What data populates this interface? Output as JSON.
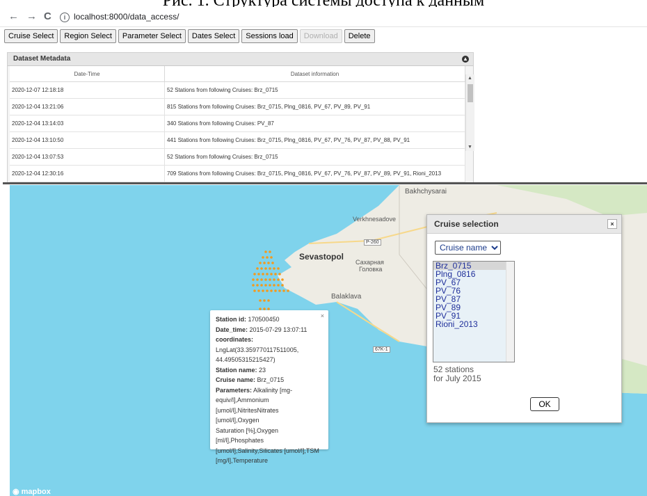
{
  "caption": "Рис. 1. Структура системы доступа к данным",
  "browser": {
    "back_icon": "←",
    "forward_icon": "→",
    "reload_icon": "C",
    "url": "localhost:8000/data_access/"
  },
  "toolbar": {
    "buttons": [
      "Cruise Select",
      "Region Select",
      "Parameter Select",
      "Dates Select",
      "Sessions load",
      "Download",
      "Delete"
    ]
  },
  "metadata": {
    "title": "Dataset Metadata",
    "columns": [
      "Date-Time",
      "Dataset information"
    ],
    "rows": [
      [
        "2020-12-07 12:18:18",
        "52 Stations from following Cruises: Brz_0715"
      ],
      [
        "2020-12-04 13:21:06",
        "815 Stations from following Cruises: Brz_0715, Plng_0816, PV_67, PV_89, PV_91"
      ],
      [
        "2020-12-04 13:14:03",
        "340 Stations from following Cruises: PV_87"
      ],
      [
        "2020-12-04 13:10:50",
        "441 Stations from following Cruises: Brz_0715, Plng_0816, PV_67, PV_76, PV_87, PV_88, PV_91"
      ],
      [
        "2020-12-04 13:07:53",
        "52 Stations from following Cruises: Brz_0715"
      ],
      [
        "2020-12-04 12:30:16",
        "709 Stations from following Cruises: Brz_0715, Plng_0816, PV_67, PV_76, PV_87, PV_89, PV_91, Rioni_2013"
      ]
    ]
  },
  "map": {
    "labels": {
      "bakhchysarai": "Bakhchysarai",
      "verkhnesadove": "Verkhnesadove",
      "sevastopol": "Sevastopol",
      "sakharnaya1": "Сахарная",
      "sakharnaya2": "Головка",
      "balaklava": "Balaklava",
      "road_p260": "P-260",
      "road_67k1": "67K-1"
    },
    "attribution": "mapbox",
    "colors": {
      "sea": "#7fd3ec",
      "land": "#eeece4",
      "stations": "#f29a1f"
    }
  },
  "popup": {
    "station_id_label": "Station id:",
    "station_id": "170500450",
    "date_label": "Date_time:",
    "date": "2015-07-29 13:07:11",
    "coords_label": "coordinates:",
    "coords_line1": "LngLat(33.359770117511005,",
    "coords_line2": "44.49505315215427)",
    "station_name_label": "Station name:",
    "station_name": "23",
    "cruise_label": "Cruise name:",
    "cruise": "Brz_0715",
    "params_label": "Parameters:",
    "params_lines": [
      "Alkalinity [mg-",
      "equiv/l],Ammonium",
      "[umol/l],NitritesNitrates [umol/l],Oxygen",
      "Saturation [%],Oxygen [ml/l],Phosphates",
      "[umol/l],Salinity,Silicates [umol/l],TSM",
      "[mg/l],Temperature"
    ]
  },
  "dialog": {
    "title": "Cruise selection",
    "select_value": "Cruise name",
    "cruises": [
      "Brz_0715",
      "Plng_0816",
      "PV_67",
      "PV_76",
      "PV_87",
      "PV_89",
      "PV_91",
      "Rioni_2013"
    ],
    "info_line1": "52 stations",
    "info_line2": "for July 2015",
    "ok_label": "OK"
  }
}
